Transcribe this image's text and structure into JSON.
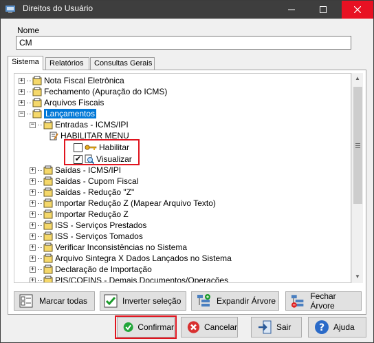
{
  "window": {
    "title": "Direitos do Usuário"
  },
  "form": {
    "name_label": "Nome",
    "name_value": "CM"
  },
  "tabs": [
    {
      "label": "Sistema",
      "active": true
    },
    {
      "label": "Relatórios",
      "active": false
    },
    {
      "label": "Consultas Gerais",
      "active": false
    }
  ],
  "tree": {
    "items": [
      {
        "label": "Nota Fiscal Eletrônica"
      },
      {
        "label": "Fechamento (Apuração do ICMS)"
      },
      {
        "label": "Arquivos Fiscais"
      },
      {
        "label": "Lançamentos"
      },
      {
        "label": "Entradas - ICMS/IPI"
      },
      {
        "label": "HABILITAR MENU"
      },
      {
        "label": "Habilitar",
        "checked": false
      },
      {
        "label": "Visualizar",
        "checked": true
      },
      {
        "label": "Saídas - ICMS/IPI"
      },
      {
        "label": "Saídas - Cupom Fiscal"
      },
      {
        "label": "Saídas - Redução \"Z\""
      },
      {
        "label": "Importar Redução Z (Mapear Arquivo Texto)"
      },
      {
        "label": "Importar Redução Z"
      },
      {
        "label": "ISS - Serviços Prestados"
      },
      {
        "label": "ISS - Serviços Tomados"
      },
      {
        "label": "Verificar Inconsistências no Sistema"
      },
      {
        "label": "Arquivo Sintegra X Dados Lançados no Sistema"
      },
      {
        "label": "Declaração de Importação"
      },
      {
        "label": "PIS/COFINS - Demais Documentos/Operações"
      }
    ]
  },
  "tree_buttons": {
    "mark_all": "Marcar todas",
    "invert": "Inverter seleção",
    "expand": "Expandir Árvore",
    "collapse": "Fechar Árvore"
  },
  "dialog_buttons": {
    "confirm": "Confirmar",
    "cancel": "Cancelar",
    "exit": "Sair",
    "help": "Ajuda"
  },
  "colors": {
    "selection": "#0078d7",
    "highlight_box": "#e0141e",
    "titlebar": "#3e3e3e"
  }
}
